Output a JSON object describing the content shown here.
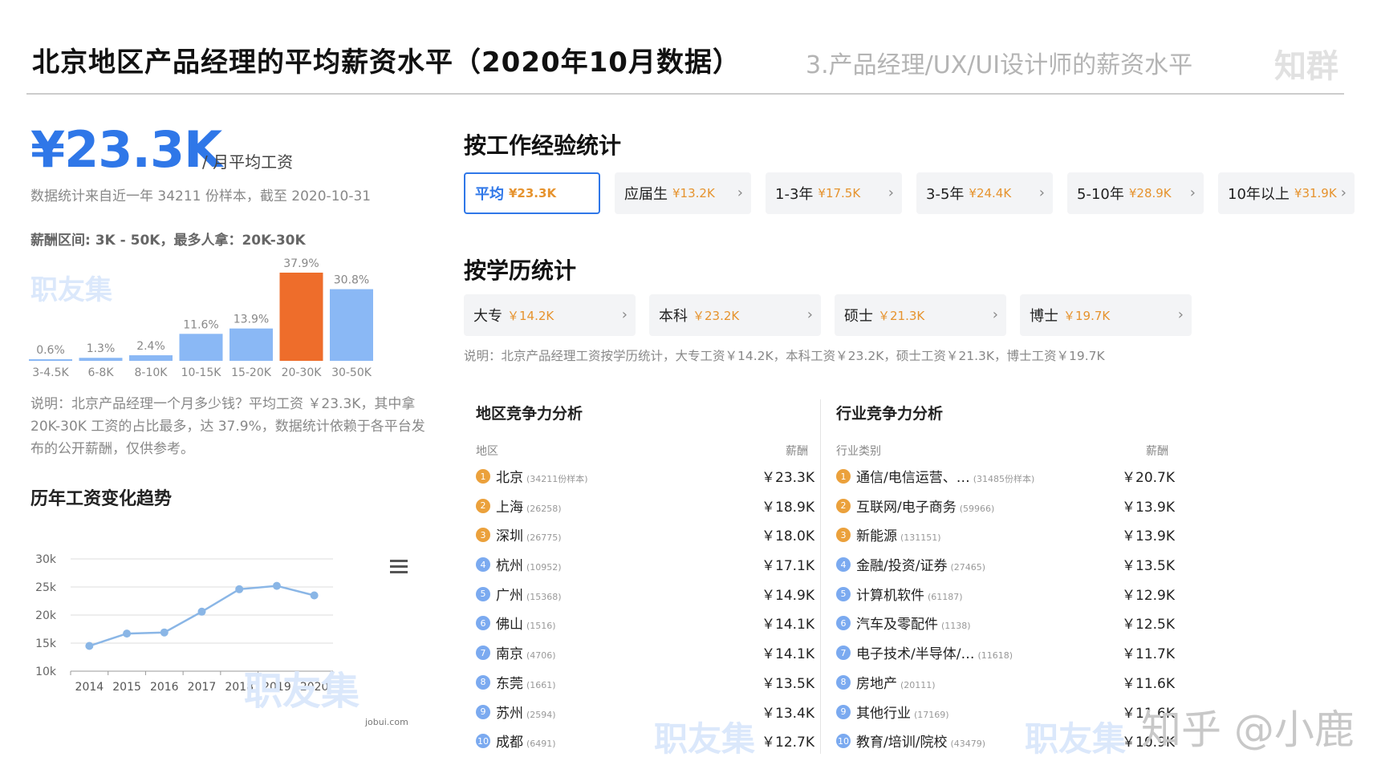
{
  "header": {
    "title": "北京地区产品经理的平均薪资水平（2020年10月数据）",
    "subtitle": "3.产品经理/UX/UI设计师的薪资水平",
    "logo": "知群"
  },
  "summary": {
    "salary": "¥23.3K",
    "unit": "/ 月平均工资",
    "sample_note": "数据统计来自近一年 34211 份样本，截至 2020-10-31",
    "range_note": "薪酬区间: 3K - 50K，最多人拿：20K-30K",
    "description": "说明：北京产品经理一个月多少钱？平均工资 ￥23.3K，其中拿 20K-30K 工资的占比最多，达 37.9%，数据统计依赖于各平台发布的公开薪酬，仅供参考。"
  },
  "watermark": "职友集",
  "zhihu_watermark": "知乎 @小鹿",
  "chart_data": [
    {
      "type": "bar",
      "categories": [
        "3-4.5K",
        "6-8K",
        "8-10K",
        "10-15K",
        "15-20K",
        "20-30K",
        "30-50K"
      ],
      "values": [
        0.6,
        1.3,
        2.4,
        11.6,
        13.9,
        37.9,
        30.8
      ],
      "labels": [
        "0.6%",
        "1.3%",
        "2.4%",
        "11.6%",
        "13.9%",
        "37.9%",
        "30.8%"
      ],
      "highlight_index": 5,
      "colors": {
        "normal": "#8ab8f5",
        "highlight": "#ee6d2b"
      },
      "ylim": [
        0,
        37.9
      ]
    },
    {
      "type": "line",
      "title": "历年工资变化趋势",
      "x": [
        "2014",
        "2015",
        "2016",
        "2017",
        "2018",
        "2019",
        "2020"
      ],
      "values": [
        14.5,
        16.7,
        16.9,
        20.6,
        24.6,
        25.2,
        23.5
      ],
      "y_ticks": [
        "10k",
        "15k",
        "20k",
        "25k",
        "30k"
      ],
      "ylim": [
        10,
        30
      ],
      "grid": true,
      "source": "jobui.com",
      "color": "#8ab6e6"
    }
  ],
  "experience": {
    "title": "按工作经验统计",
    "items": [
      {
        "label": "平均",
        "value": "¥23.3K",
        "active": true
      },
      {
        "label": "应届生",
        "value": "¥13.2K"
      },
      {
        "label": "1-3年",
        "value": "¥17.5K"
      },
      {
        "label": "3-5年",
        "value": "¥24.4K"
      },
      {
        "label": "5-10年",
        "value": "¥28.9K"
      },
      {
        "label": "10年以上",
        "value": "¥31.9K"
      }
    ]
  },
  "education": {
    "title": "按学历统计",
    "items": [
      {
        "label": "大专",
        "value": "￥14.2K"
      },
      {
        "label": "本科",
        "value": "￥23.2K"
      },
      {
        "label": "硕士",
        "value": "￥21.3K"
      },
      {
        "label": "博士",
        "value": "￥19.7K"
      }
    ],
    "note": "说明：北京产品经理工资按学历统计，大专工资￥14.2K，本科工资￥23.2K，硕士工资￥21.3K，博士工资￥19.7K"
  },
  "region": {
    "title": "地区竞争力分析",
    "col_name": "地区",
    "col_salary": "薪酬",
    "rows": [
      {
        "rank": "1",
        "name": "北京",
        "count": "(34211份样本)",
        "salary": "￥23.3K"
      },
      {
        "rank": "2",
        "name": "上海",
        "count": "(26258)",
        "salary": "￥18.9K"
      },
      {
        "rank": "3",
        "name": "深圳",
        "count": "(26775)",
        "salary": "￥18.0K"
      },
      {
        "rank": "4",
        "name": "杭州",
        "count": "(10952)",
        "salary": "￥17.1K"
      },
      {
        "rank": "5",
        "name": "广州",
        "count": "(15368)",
        "salary": "￥14.9K"
      },
      {
        "rank": "6",
        "name": "佛山",
        "count": "(1516)",
        "salary": "￥14.1K"
      },
      {
        "rank": "7",
        "name": "南京",
        "count": "(4706)",
        "salary": "￥14.1K"
      },
      {
        "rank": "8",
        "name": "东莞",
        "count": "(1661)",
        "salary": "￥13.5K"
      },
      {
        "rank": "9",
        "name": "苏州",
        "count": "(2594)",
        "salary": "￥13.4K"
      },
      {
        "rank": "10",
        "name": "成都",
        "count": "(6491)",
        "salary": "￥12.7K"
      }
    ]
  },
  "industry": {
    "title": "行业竞争力分析",
    "col_name": "行业类别",
    "col_salary": "薪酬",
    "rows": [
      {
        "rank": "1",
        "name": "通信/电信运营、…",
        "count": "(31485份样本)",
        "salary": "￥20.7K"
      },
      {
        "rank": "2",
        "name": "互联网/电子商务",
        "count": "(59966)",
        "salary": "￥13.9K"
      },
      {
        "rank": "3",
        "name": "新能源",
        "count": "(131151)",
        "salary": "￥13.9K"
      },
      {
        "rank": "4",
        "name": "金融/投资/证券",
        "count": "(27465)",
        "salary": "￥13.5K"
      },
      {
        "rank": "5",
        "name": "计算机软件",
        "count": "(61187)",
        "salary": "￥12.9K"
      },
      {
        "rank": "6",
        "name": "汽车及零配件",
        "count": "(1138)",
        "salary": "￥12.5K"
      },
      {
        "rank": "7",
        "name": "电子技术/半导体/…",
        "count": "(11618)",
        "salary": "￥11.7K"
      },
      {
        "rank": "8",
        "name": "房地产",
        "count": "(20111)",
        "salary": "￥11.6K"
      },
      {
        "rank": "9",
        "name": "其他行业",
        "count": "(17169)",
        "salary": "￥11.6K"
      },
      {
        "rank": "10",
        "name": "教育/培训/院校",
        "count": "(43479)",
        "salary": "￥10.9K"
      }
    ]
  }
}
